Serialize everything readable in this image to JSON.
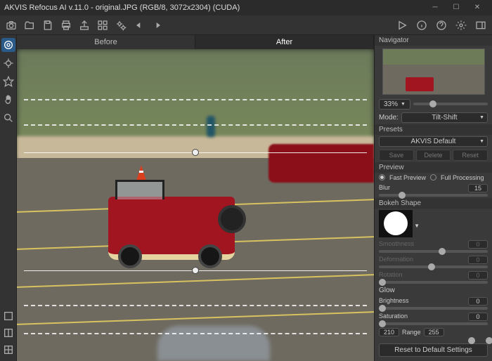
{
  "title": "AKVIS Refocus AI v.11.0 - original.JPG (RGB/8, 3072x2304) (CUDA)",
  "tabs": {
    "before": "Before",
    "after": "After"
  },
  "sidebar": {
    "nav_header": "Navigator",
    "zoom": "33%",
    "mode_label": "Mode:",
    "mode_value": "Tilt-Shift",
    "presets_label": "Presets",
    "presets_value": "AKVIS Default",
    "btn_save": "Save",
    "btn_delete": "Delete",
    "btn_reset": "Reset",
    "preview_label": "Preview",
    "fast_preview": "Fast Preview",
    "full_processing": "Full Processing",
    "blur_label": "Blur",
    "blur_value": "15",
    "bokeh_label": "Bokeh Shape",
    "smooth_label": "Smoothness",
    "smooth_value": "0",
    "deform_label": "Deformation",
    "deform_value": "0",
    "rotation_label": "Rotation",
    "rotation_value": "0",
    "glow_label": "Glow",
    "bright_label": "Brightness",
    "bright_value": "0",
    "sat_label": "Saturation",
    "sat_value": "0",
    "range_low": "210",
    "range_label": "Range",
    "range_high": "255",
    "reset_default": "Reset to Default Settings"
  }
}
